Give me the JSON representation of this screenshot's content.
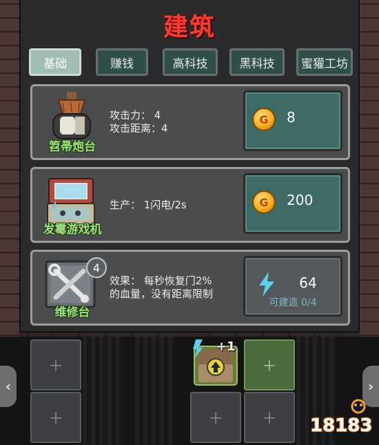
{
  "dialog": {
    "title": "建筑"
  },
  "tabs": [
    {
      "label": "基础",
      "active": true
    },
    {
      "label": "赚钱",
      "active": false
    },
    {
      "label": "高科技",
      "active": false
    },
    {
      "label": "黑科技",
      "active": false
    },
    {
      "label": "蜜獾工坊",
      "active": false
    }
  ],
  "buildings": [
    {
      "name": "笤帚炮台",
      "icon": "broom-turret-icon",
      "desc_lines": [
        "攻击力：  4",
        "攻击距离：4"
      ],
      "currency_icon": "gold-coin-icon",
      "coin_letter": "G",
      "cost": "8"
    },
    {
      "name": "发霉游戏机",
      "icon": "moldy-game-console-icon",
      "desc_lines": [
        "生产：   1闪电/2s"
      ],
      "currency_icon": "gold-coin-icon",
      "coin_letter": "G",
      "cost": "200"
    },
    {
      "name": "维修台",
      "icon": "repair-bench-icon",
      "badge": "4",
      "desc_lines": [
        "效果：    每秒恢复门2%",
        "的血量，没有距离限制"
      ],
      "currency_icon": "lightning-icon",
      "cost": "64",
      "build_limit": "可建造 0/4"
    }
  ],
  "board": {
    "placed_bonus": "+1"
  },
  "watermark": {
    "text": "18183",
    "icon": "18183-logo-icon"
  },
  "colors": {
    "title": "#ff3b2f",
    "building_name": "#9fe27c",
    "buy_button": "#3d6b65",
    "tab_active": "#9fbdb4",
    "tab_inactive": "#2f4f4a"
  }
}
